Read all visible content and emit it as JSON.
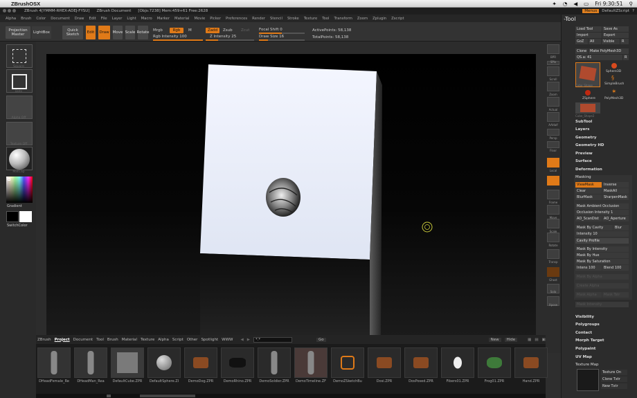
{
  "macbar": {
    "app": "ZBrushOSX",
    "clock": "Fri 9:30:51"
  },
  "titlebar": {
    "version": "ZBrush 4[YMMM-RHEX-ADEJ-FYSU]",
    "doc": "ZBrush Document",
    "stats": "[Objs:7238] Mem:459+61 Free:2628",
    "menus_chip": "Menus",
    "script": "DefaultZScript"
  },
  "menus": [
    "Alpha",
    "Brush",
    "Color",
    "Document",
    "Draw",
    "Edit",
    "File",
    "Layer",
    "Light",
    "Macro",
    "Marker",
    "Material",
    "Movie",
    "Picker",
    "Preferences",
    "Render",
    "Stencil",
    "Stroke",
    "Texture",
    "Tool",
    "Transform",
    "Zoom",
    "Zplugin",
    "Zscript"
  ],
  "top": {
    "projection_master": "Projection Master",
    "lightbox": "LightBox",
    "quick_sketch": "Quick Sketch",
    "edit": "Edit",
    "draw": "Draw",
    "move": "Move",
    "scale": "Scale",
    "rotate": "Rotate",
    "mrgb": "Mrgb",
    "rgb": "Rgb",
    "m": "M",
    "rgb_intensity": "Rgb Intensity 100",
    "zadd": "Zadd",
    "zsub": "Zsub",
    "zcut": "Zcut",
    "z_intensity": "Z Intensity 25",
    "focal_shift": "Focal Shift 0",
    "draw_size": "Draw Size 16",
    "active_points": "ActivePoints: 58,138",
    "total_points": "TotalPoints: 58,138",
    "rgb_intensity_level": 1.0,
    "z_intensity_level": 0.25,
    "focal_shift_level": 0.5,
    "draw_size_level": 0.2
  },
  "left": {
    "labels": [
      "Square",
      "Dots",
      "Alpha Off",
      "Texture Off",
      "MatCap",
      "Gradient",
      "SwitchColor"
    ]
  },
  "right": {
    "labels": [
      "BPR",
      "SPix",
      "Scroll",
      "Zoom",
      "Actual",
      "AAHalf",
      "Persp",
      "Floor",
      "Local",
      "Frame",
      "Move",
      "Scale",
      "Rotate",
      "Transp",
      "Ghost",
      "Solo",
      "Xpose"
    ]
  },
  "lightbox": {
    "tabs": [
      "ZBrush",
      "Project",
      "Document",
      "Tool",
      "Brush",
      "Material",
      "Texture",
      "Alpha",
      "Script",
      "Other",
      "Spotlight",
      "WWW"
    ],
    "active_tab": "Project",
    "path": "*.*",
    "go": "Go",
    "new": "New",
    "hide": "Hide",
    "items": [
      "DHeadFemale_Re",
      "DHeadMan_Rea",
      "DefaultCube.ZPR",
      "DefaultSphere.ZI",
      "DemoDog.ZPR",
      "DemoRhino.ZPR",
      "DemoSoldier.ZPR",
      "DemoTimeline.ZF",
      "DemoZSketchBu",
      "Dosi.ZPR",
      "DosPosed.ZPR",
      "Fibers01.ZPR",
      "Frog01.ZPR",
      "Hand.ZPR"
    ]
  },
  "tool": {
    "title": "Tool",
    "load": "Load Tool",
    "save": "Save As",
    "import": "Import",
    "export": "Export",
    "goz": "GoZ",
    "all": "All",
    "visible": "Visible",
    "r": "R",
    "clone": "Clone",
    "make_polymesh": "Make PolyMesh3D",
    "current": "QS.a: 41",
    "subtools": [
      "Cube_Shape",
      "Sphere3D",
      "SimpleBrush",
      "ZSphere",
      "PolyMesh3D",
      "Cube_Shape2"
    ],
    "sections": [
      "SubTool",
      "Layers",
      "Geometry",
      "Geometry HD",
      "Preview",
      "Surface",
      "Deformation"
    ],
    "masking": {
      "title": "Masking",
      "view": "ViewMask",
      "inverse": "Inverse",
      "clear": "Clear",
      "mask_all": "MaskAll",
      "blur": "BlurMask",
      "sharpen": "SharpenMask",
      "ambient": "Mask Ambient Occlusion",
      "occlusion": "Occlusion Intensity 1",
      "ao_scan": "AO_ScanDist",
      "ao_aperture": "AO_Aperture",
      "cavity": "Mask By Cavity",
      "blur_lbl": "Blur",
      "intensity": "Intensity 10",
      "cavity_profile": "Cavity Profile",
      "by_intensity": "Mask By Intensity",
      "by_hue": "Mask By Hue",
      "by_saturation": "Mask By Saturation",
      "intens": "Intens 100",
      "blend": "Blend 100",
      "by_alpha": "Mask By Alpha",
      "create_alpha": "Create Alpha",
      "mask_alpha": "Mask Alpha",
      "mask_tstr": "Mask Tstr",
      "mask_intens": "Mask Intensity"
    },
    "sections2": [
      "Visibility",
      "Polygroups",
      "Contact",
      "Morph Target",
      "Polypaint",
      "UV Map",
      "Texture Map"
    ],
    "texture_on": "Texture On",
    "clone_txtr": "Clone Txtr",
    "new_txtr": "New Txtr"
  },
  "colors": {
    "accent": "#e07a18"
  }
}
